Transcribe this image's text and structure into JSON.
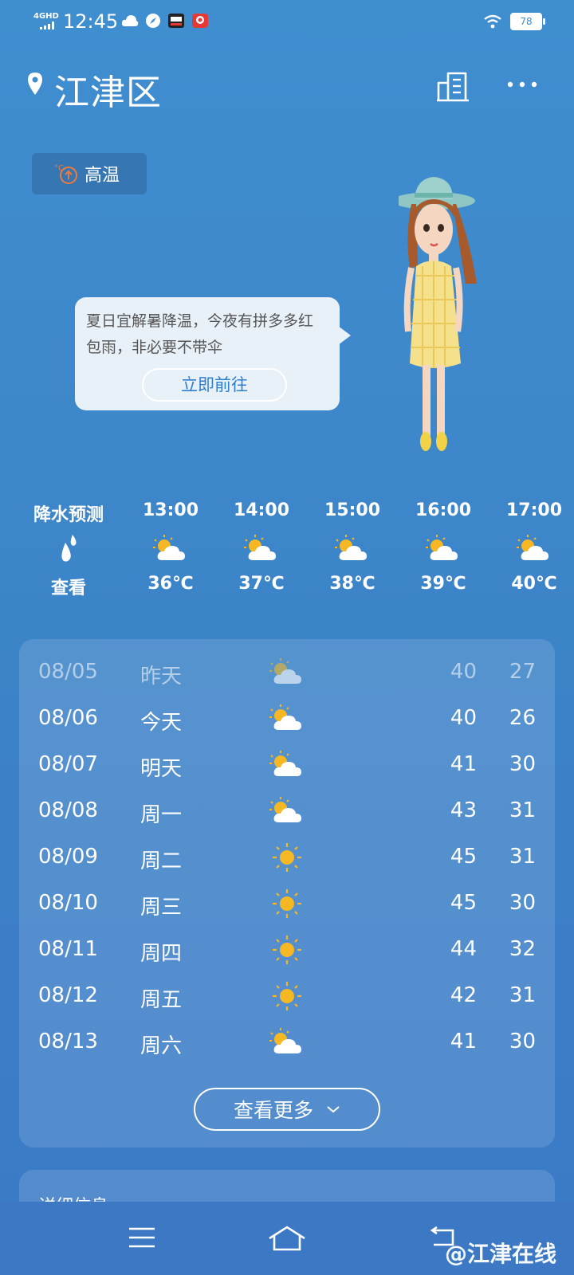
{
  "status_bar": {
    "network": "4GHD",
    "time": "12:45",
    "battery": "78"
  },
  "header": {
    "city": "江津区",
    "more_label": "···"
  },
  "alert": {
    "label": "高温"
  },
  "bubble": {
    "message": "夏日宜解暑降温，今夜有拼多多红包雨，非必要不带伞",
    "button": "立即前往"
  },
  "hourly": {
    "precip_title": "降水预测",
    "precip_action": "查看",
    "hours": [
      {
        "time": "13:00",
        "temp": "36℃",
        "icon": "partly-cloudy-icon"
      },
      {
        "time": "14:00",
        "temp": "37℃",
        "icon": "partly-cloudy-icon"
      },
      {
        "time": "15:00",
        "temp": "38℃",
        "icon": "partly-cloudy-icon"
      },
      {
        "time": "16:00",
        "temp": "39℃",
        "icon": "partly-cloudy-icon"
      },
      {
        "time": "17:00",
        "temp": "40℃",
        "icon": "partly-cloudy-icon"
      }
    ]
  },
  "daily": {
    "days": [
      {
        "date": "08/05",
        "weekday": "昨天",
        "icon": "partly-cloudy-icon",
        "high": "40",
        "low": "27",
        "past": true
      },
      {
        "date": "08/06",
        "weekday": "今天",
        "icon": "partly-cloudy-icon",
        "high": "40",
        "low": "26"
      },
      {
        "date": "08/07",
        "weekday": "明天",
        "icon": "partly-cloudy-icon",
        "high": "41",
        "low": "30"
      },
      {
        "date": "08/08",
        "weekday": "周一",
        "icon": "partly-cloudy-icon",
        "high": "43",
        "low": "31"
      },
      {
        "date": "08/09",
        "weekday": "周二",
        "icon": "sunny-icon",
        "high": "45",
        "low": "31"
      },
      {
        "date": "08/10",
        "weekday": "周三",
        "icon": "sunny-icon",
        "high": "45",
        "low": "30"
      },
      {
        "date": "08/11",
        "weekday": "周四",
        "icon": "sunny-icon",
        "high": "44",
        "low": "32"
      },
      {
        "date": "08/12",
        "weekday": "周五",
        "icon": "sunny-icon",
        "high": "42",
        "low": "31"
      },
      {
        "date": "08/13",
        "weekday": "周六",
        "icon": "partly-cloudy-icon",
        "high": "41",
        "low": "30"
      }
    ],
    "more_label": "查看更多"
  },
  "detail": {
    "label": "详细信息"
  },
  "watermark": "@江津在线",
  "colors": {
    "background": "#3f8ed0",
    "accent": "#2f7fd0",
    "sun": "#f5b824",
    "alert_icon": "#f07a3a"
  }
}
